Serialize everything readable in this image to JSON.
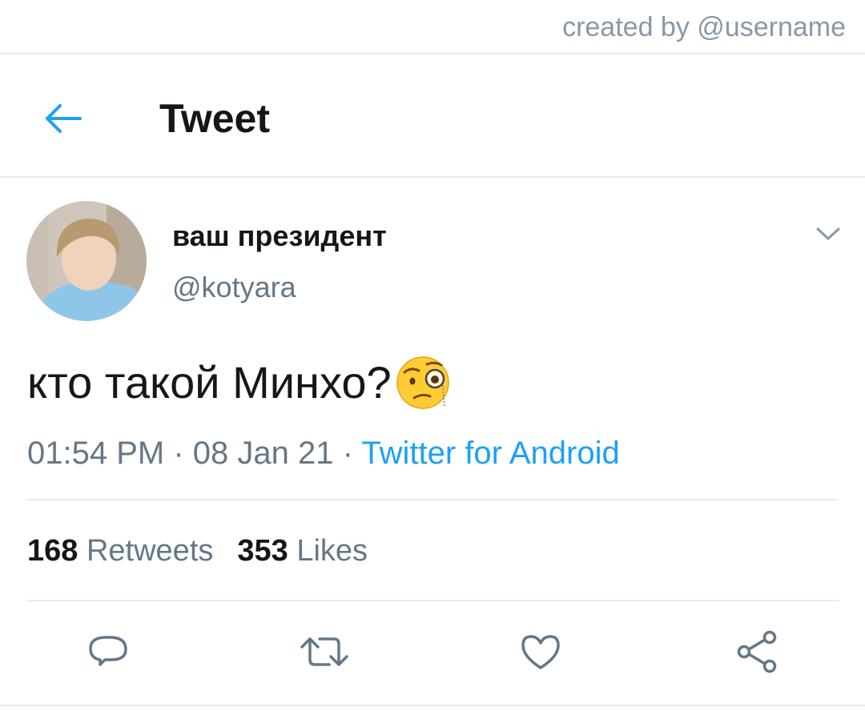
{
  "watermark": "created by @username",
  "header": {
    "title": "Tweet",
    "back_icon": "arrow-left-icon"
  },
  "tweet": {
    "display_name": "ваш президент",
    "handle": "@kotyara",
    "text": "кто такой Минхо?",
    "emoji": "face-with-monocle",
    "time": "01:54 PM",
    "date": "08 Jan 21",
    "separator": "·",
    "source": "Twitter for Android"
  },
  "stats": {
    "retweets_count": "168",
    "retweets_label": "Retweets",
    "likes_count": "353",
    "likes_label": "Likes"
  },
  "actions": [
    "reply-icon",
    "retweet-icon",
    "like-icon",
    "share-icon"
  ],
  "colors": {
    "accent": "#1da1f2",
    "secondary_text": "#657786",
    "divider": "#e6ecf0"
  }
}
